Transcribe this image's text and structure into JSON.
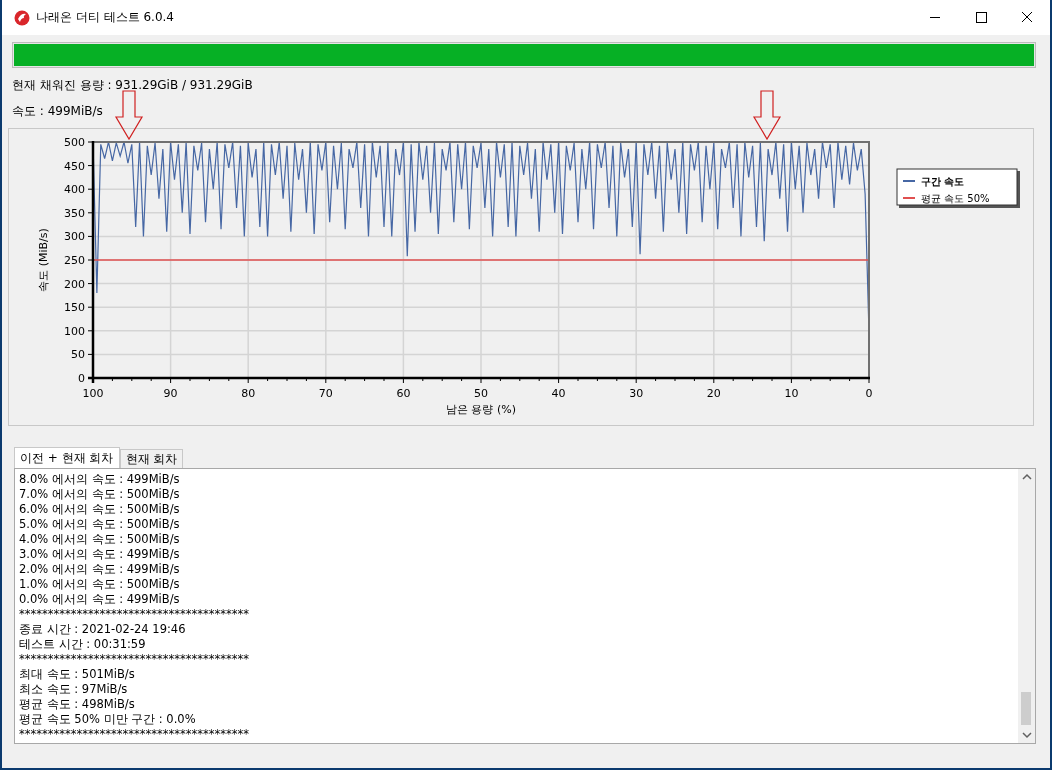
{
  "window": {
    "title": "나래온 더티 테스트 6.0.4"
  },
  "progress": {
    "level": 1.0
  },
  "filled_capacity": "현재 채워진 용량 : 931.29GiB / 931.29GiB",
  "speed": "속도 : 499MiB/s",
  "chart": {
    "chart_data": {
      "type": "line",
      "grid": true,
      "legend": "right",
      "xlabel": "남은 용량 (%)",
      "ylabel": "속도 (MiB/s)",
      "xlim": [
        100,
        0
      ],
      "ylim": [
        0,
        500
      ],
      "xticks": [
        100,
        90,
        80,
        70,
        60,
        50,
        40,
        30,
        20,
        10,
        0
      ],
      "yticks": [
        0,
        50,
        100,
        150,
        200,
        250,
        300,
        350,
        400,
        450,
        500
      ],
      "series": [
        {
          "name": "구간 속도",
          "color": "#4667a4",
          "x": [
            100,
            99.5,
            99,
            98.5,
            98,
            97.5,
            97,
            96.5,
            96,
            95.5,
            95,
            94.5,
            94,
            93.5,
            93,
            92.5,
            92,
            91.5,
            91,
            90.5,
            90,
            89.5,
            89,
            88.5,
            88,
            87.5,
            87,
            86.5,
            86,
            85.5,
            85,
            84.5,
            84,
            83.5,
            83,
            82.5,
            82,
            81.5,
            81,
            80.5,
            80,
            79.5,
            79,
            78.5,
            78,
            77.5,
            77,
            76.5,
            76,
            75.5,
            75,
            74.5,
            74,
            73.5,
            73,
            72.5,
            72,
            71.5,
            71,
            70.5,
            70,
            69.5,
            69,
            68.5,
            68,
            67.5,
            67,
            66.5,
            66,
            65.5,
            65,
            64.5,
            64,
            63.5,
            63,
            62.5,
            62,
            61.5,
            61,
            60.5,
            60,
            59.5,
            59,
            58.5,
            58,
            57.5,
            57,
            56.5,
            56,
            55.5,
            55,
            54.5,
            54,
            53.5,
            53,
            52.5,
            52,
            51.5,
            51,
            50.5,
            50,
            49.5,
            49,
            48.5,
            48,
            47.5,
            47,
            46.5,
            46,
            45.5,
            45,
            44.5,
            44,
            43.5,
            43,
            42.5,
            42,
            41.5,
            41,
            40.5,
            40,
            39.5,
            39,
            38.5,
            38,
            37.5,
            37,
            36.5,
            36,
            35.5,
            35,
            34.5,
            34,
            33.5,
            33,
            32.5,
            32,
            31.5,
            31,
            30.5,
            30,
            29.5,
            29,
            28.5,
            28,
            27.5,
            27,
            26.5,
            26,
            25.5,
            25,
            24.5,
            24,
            23.5,
            23,
            22.5,
            22,
            21.5,
            21,
            20.5,
            20,
            19.5,
            19,
            18.5,
            18,
            17.5,
            17,
            16.5,
            16,
            15.5,
            15,
            14.5,
            14,
            13.5,
            13,
            12.5,
            12,
            11.5,
            11,
            10.5,
            10,
            9.5,
            9,
            8.5,
            8,
            7.5,
            7,
            6.5,
            6,
            5.5,
            5,
            4.5,
            4,
            3.5,
            3,
            2.5,
            2,
            1.5,
            1,
            0.5,
            0
          ],
          "values": [
            500,
            180,
            495,
            465,
            500,
            460,
            498,
            470,
            500,
            455,
            495,
            320,
            500,
            300,
            492,
            430,
            498,
            380,
            485,
            310,
            500,
            420,
            495,
            350,
            500,
            305,
            492,
            440,
            498,
            330,
            485,
            400,
            500,
            315,
            495,
            445,
            500,
            360,
            492,
            300,
            498,
            425,
            485,
            320,
            500,
            300,
            495,
            430,
            500,
            380,
            492,
            310,
            498,
            420,
            485,
            350,
            500,
            305,
            495,
            440,
            500,
            330,
            492,
            400,
            498,
            315,
            485,
            445,
            500,
            360,
            495,
            300,
            500,
            425,
            492,
            320,
            498,
            300,
            485,
            430,
            500,
            258,
            495,
            310,
            500,
            420,
            492,
            350,
            498,
            305,
            485,
            440,
            500,
            330,
            495,
            400,
            500,
            315,
            492,
            445,
            498,
            360,
            485,
            300,
            500,
            425,
            495,
            320,
            500,
            300,
            492,
            430,
            498,
            380,
            485,
            310,
            500,
            420,
            495,
            350,
            500,
            305,
            492,
            440,
            498,
            330,
            485,
            400,
            500,
            315,
            495,
            445,
            500,
            360,
            492,
            300,
            498,
            425,
            485,
            320,
            500,
            262,
            495,
            430,
            500,
            380,
            492,
            310,
            498,
            420,
            485,
            350,
            500,
            305,
            495,
            440,
            500,
            330,
            492,
            400,
            498,
            315,
            485,
            445,
            500,
            360,
            495,
            300,
            500,
            425,
            492,
            320,
            498,
            290,
            485,
            430,
            500,
            380,
            495,
            310,
            500,
            400,
            492,
            350,
            498,
            430,
            485,
            380,
            500,
            445,
            495,
            360,
            500,
            420,
            492,
            410,
            498,
            440,
            485,
            390,
            95
          ]
        },
        {
          "name": "평균 속도 50%",
          "color": "#e05050",
          "x": [
            100,
            0
          ],
          "values": [
            250,
            250
          ]
        }
      ]
    }
  },
  "tabs": [
    {
      "label": "이전 + 현재 회차",
      "selected": true
    },
    {
      "label": "현재 회차",
      "selected": false
    }
  ],
  "log_lines": [
    "8.0% 에서의 속도 : 499MiB/s",
    "7.0% 에서의 속도 : 500MiB/s",
    "6.0% 에서의 속도 : 500MiB/s",
    "5.0% 에서의 속도 : 500MiB/s",
    "4.0% 에서의 속도 : 500MiB/s",
    "3.0% 에서의 속도 : 499MiB/s",
    "2.0% 에서의 속도 : 499MiB/s",
    "1.0% 에서의 속도 : 500MiB/s",
    "0.0% 에서의 속도 : 499MiB/s",
    "****************************************",
    "종료 시간 : 2021-02-24 19:46",
    "테스트 시간 : 00:31:59",
    "****************************************",
    "최대 속도 : 501MiB/s",
    "최소 속도 : 97MiB/s",
    "평균 속도 : 498MiB/s",
    "평균 속도 50% 미만 구간 : 0.0%",
    "****************************************"
  ]
}
